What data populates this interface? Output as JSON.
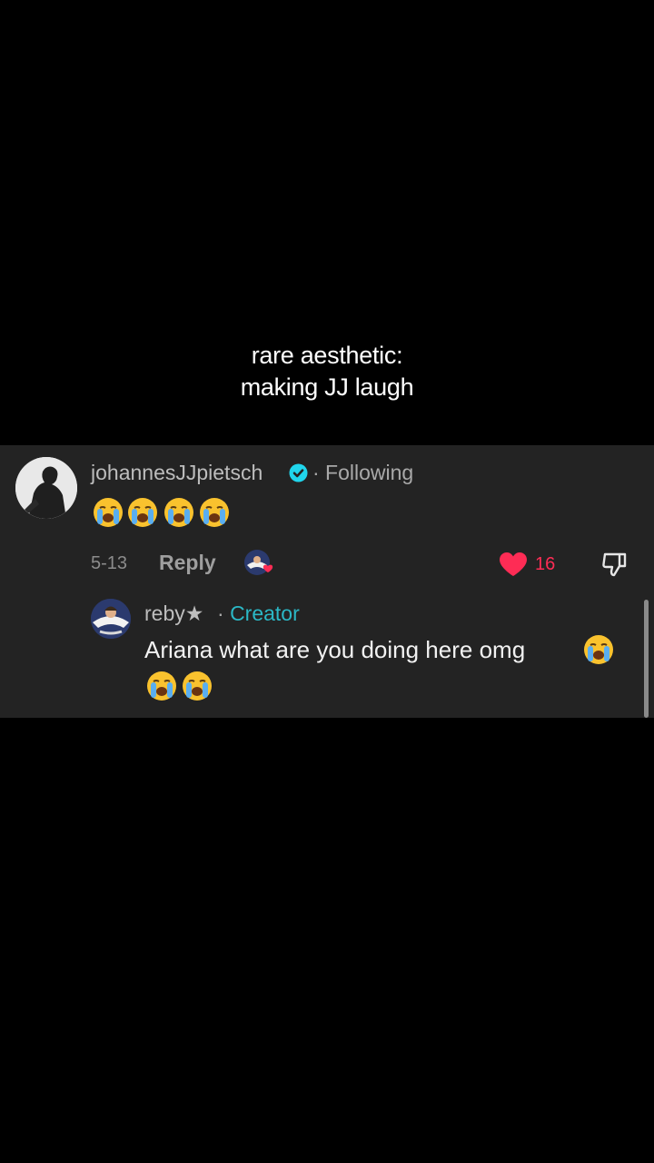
{
  "video": {
    "caption_line1": "rare aesthetic:",
    "caption_line2": "making JJ laugh"
  },
  "comment": {
    "username": "johannesJJpietsch",
    "verified_icon": "verified-badge-icon",
    "following": "· Following",
    "emojis": [
      "loudly-crying-face",
      "loudly-crying-face",
      "loudly-crying-face",
      "loudly-crying-face"
    ],
    "date": "5-13",
    "reply_label": "Reply",
    "like_count": "16",
    "accent_color": "#fe2c55"
  },
  "reply": {
    "username": "reby★",
    "separator": "·",
    "badge": "Creator",
    "text": "Ariana what are you doing here omg",
    "trailing_emojis": [
      "loudly-crying-face",
      "loudly-crying-face",
      "loudly-crying-face"
    ],
    "badge_color": "#2bb8c6"
  }
}
